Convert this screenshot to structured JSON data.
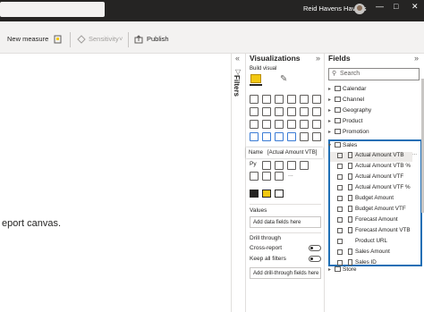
{
  "titlebar": {
    "user_name": "Reid Havens Havens"
  },
  "ribbon": {
    "new_measure": "New measure",
    "sensitivity": "Sensitivity",
    "publish": "Publish"
  },
  "canvas": {
    "partial_text": "eport canvas."
  },
  "filters": {
    "label": "Filters"
  },
  "visualizations": {
    "title": "Visualizations",
    "subtitle": "Build visual",
    "tooltip_name": "Name",
    "tooltip_value": "[Actual Amount VTB]",
    "row_py": "Py",
    "more": "...",
    "values_label": "Values",
    "values_placeholder": "Add data fields here",
    "drill_label": "Drill through",
    "cross_report_label": "Cross-report",
    "cross_report_toggle": "Off",
    "keep_filters_label": "Keep all filters",
    "keep_filters_toggle": "On",
    "drill_placeholder": "Add drill-through fields here"
  },
  "fields": {
    "title": "Fields",
    "search_placeholder": "Search",
    "tables_above": [
      "Calendar",
      "Channel",
      "Geography",
      "Product",
      "Promotion"
    ],
    "sales_table": "Sales",
    "sales_fields": [
      "Actual Amount VTB",
      "Actual Amount VTB %",
      "Actual Amount VTF",
      "Actual Amount VTF %",
      "Budget Amount",
      "Budget Amount VTF",
      "Forecast Amount",
      "Forecast Amount VTB",
      "Product URL",
      "Sales Amount",
      "Sales ID"
    ],
    "table_below": "Store",
    "more_dots": "..."
  },
  "colors": {
    "titlebar_bg": "#252423",
    "highlight_border": "#1f6fb5",
    "visual_selected": "#f2c811"
  }
}
